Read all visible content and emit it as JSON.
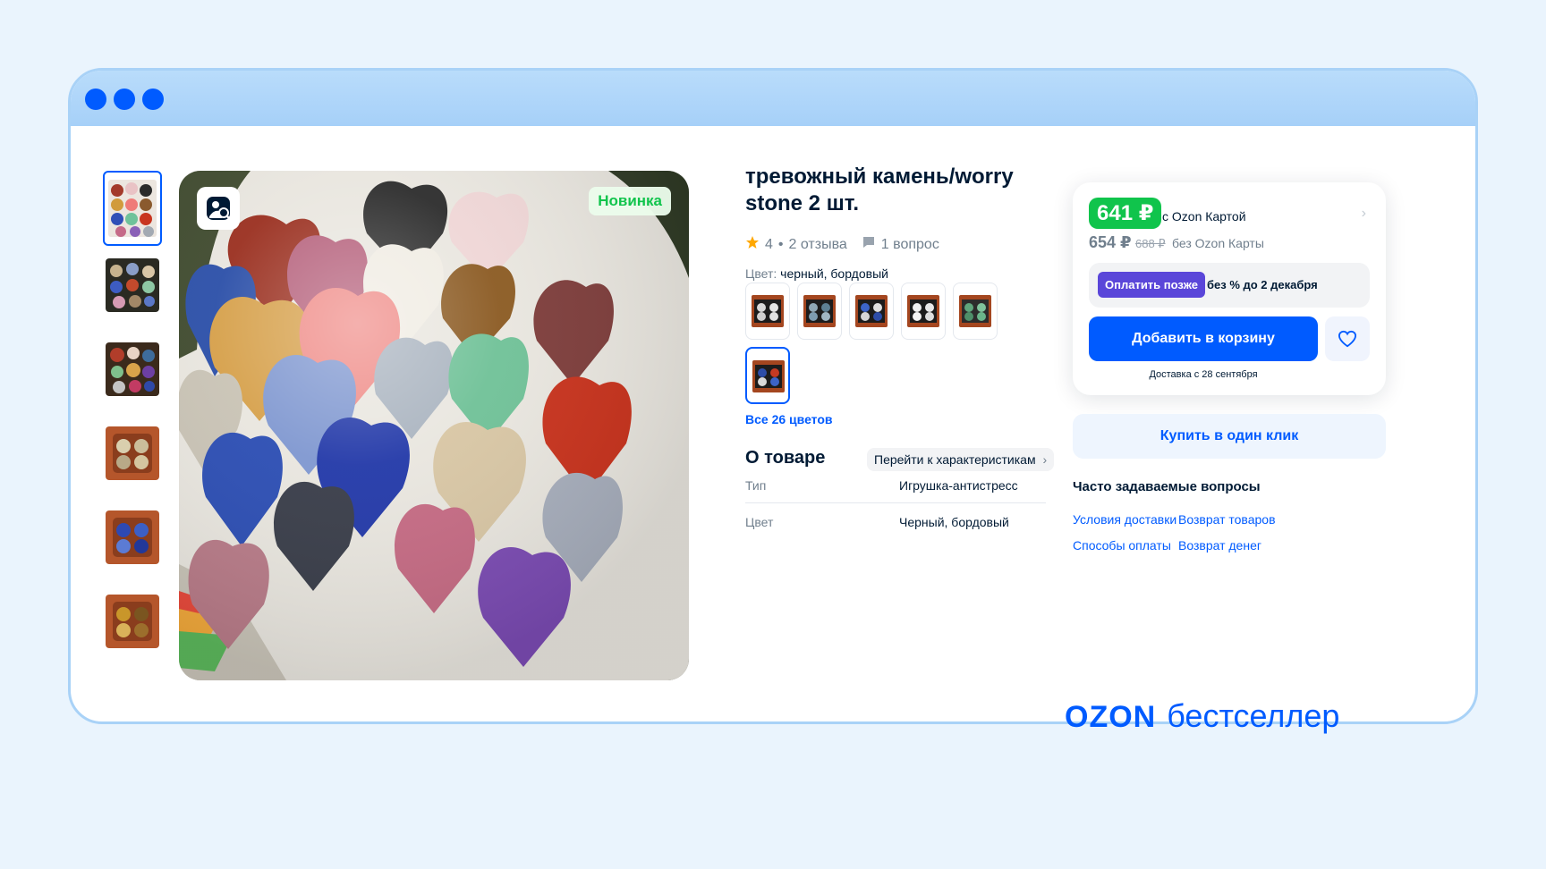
{
  "window": {
    "dots": [
      "#005bff",
      "#005bff",
      "#005bff"
    ]
  },
  "gallery": {
    "thumbnail_count": 6,
    "badge": "Новинка",
    "zoom_icon": "image-search-icon"
  },
  "product": {
    "title": "тревожный камень/worry stone 2 шт.",
    "rating": "4",
    "reviews": "2 отзыва",
    "questions": "1 вопрос",
    "color_label": "Цвет:",
    "color_value": "черный, бордовый",
    "all_colors": "Все 26 цветов"
  },
  "about": {
    "title": "О товаре",
    "specs_link": "Перейти к характеристикам",
    "specs": [
      {
        "key": "Тип",
        "value": "Игрушка-антистресс"
      },
      {
        "key": "Цвет",
        "value": "Черный, бордовый"
      }
    ]
  },
  "price": {
    "ozon_card_price": "641 ₽",
    "ozon_card_label": "с Ozon Картой",
    "regular_price": "654 ₽",
    "old_price": "688 ₽",
    "no_card_label": "без Ozon Карты",
    "pay_later_button": "Оплатить позже",
    "pay_later_text": "без % до 2 декабря",
    "add_to_cart": "Добавить в корзину",
    "delivery": "Доставка с 28 сентября",
    "one_click": "Купить в один клик"
  },
  "faq": {
    "title": "Часто задаваемые вопросы",
    "links": [
      "Условия доставки",
      "Возврат товаров",
      "Способы оплаты",
      "Возврат денег"
    ]
  },
  "brand": {
    "logo": "OZON",
    "text": "бестселлер"
  },
  "colors": {
    "accent": "#005bff",
    "price_green": "#10c44c",
    "pay_later_purple": "#5a46d9"
  }
}
